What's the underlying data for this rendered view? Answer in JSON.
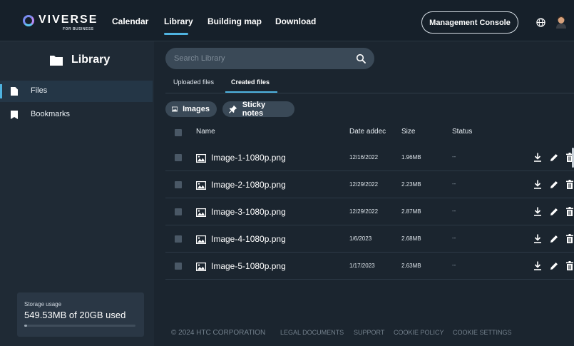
{
  "header": {
    "brand": "VIVERSE",
    "brand_sub": "FOR BUSINESS",
    "nav": [
      {
        "label": "Calendar",
        "active": false
      },
      {
        "label": "Library",
        "active": true
      },
      {
        "label": "Building map",
        "active": false
      },
      {
        "label": "Download",
        "active": false
      }
    ],
    "console_label": "Management Console",
    "globe_icon": "globe-icon",
    "avatar_icon": "user-avatar"
  },
  "sidebar": {
    "title": "Library",
    "items": [
      {
        "label": "Files",
        "icon": "file-icon",
        "active": true
      },
      {
        "label": "Bookmarks",
        "icon": "bookmark-icon",
        "active": false
      }
    ],
    "storage": {
      "caption": "Storage usage",
      "value": "549.53MB of 20GB used",
      "fraction": 0.027
    }
  },
  "main": {
    "search": {
      "placeholder": "Search Library",
      "value": ""
    },
    "tabs": [
      {
        "label": "Uploaded files",
        "active": false
      },
      {
        "label": "Created files",
        "active": true
      }
    ],
    "filters": [
      {
        "label": "Images",
        "icon": "image-icon"
      },
      {
        "label": "Sticky notes",
        "icon": "pin-icon"
      }
    ],
    "columns": [
      "Name",
      "Date addec",
      "Size",
      "Status"
    ],
    "files": [
      {
        "name": "Image-1-1080p.png",
        "date": "12/16/2022",
        "size": "1.96MB",
        "status": "--"
      },
      {
        "name": "Image-2-1080p.png",
        "date": "12/29/2022",
        "size": "2.23MB",
        "status": "--"
      },
      {
        "name": "Image-3-1080p.png",
        "date": "12/29/2022",
        "size": "2.87MB",
        "status": "--"
      },
      {
        "name": "Image-4-1080p.png",
        "date": "1/6/2023",
        "size": "2.68MB",
        "status": "--"
      },
      {
        "name": "Image-5-1080p.png",
        "date": "1/17/2023",
        "size": "2.63MB",
        "status": "--"
      }
    ]
  },
  "footer": {
    "copyright": "© 2024 HTC CORPORATION",
    "links": [
      "LEGAL DOCUMENTS",
      "SUPPORT",
      "COOKIE POLICY",
      "COOKIE SETTINGS"
    ]
  },
  "colors": {
    "accent": "#4fb3e0",
    "background": "#1b252f",
    "sidebar": "#1f2a35",
    "topbar": "#16202a"
  }
}
